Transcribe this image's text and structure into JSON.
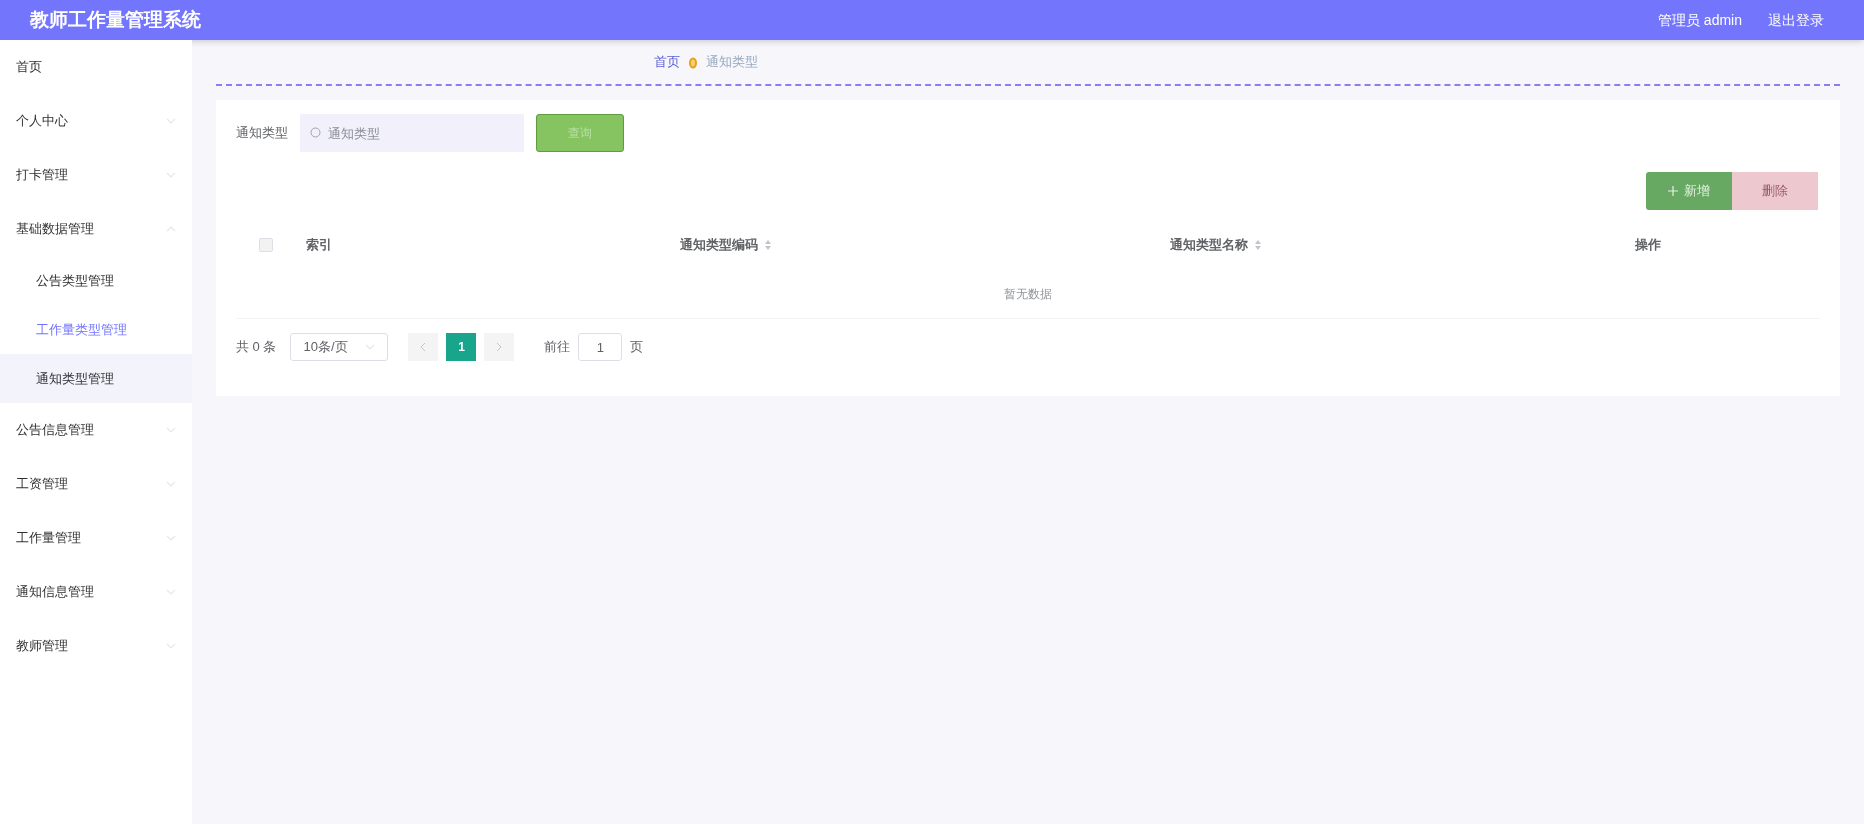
{
  "header": {
    "title": "教师工作量管理系统",
    "user": "管理员 admin",
    "logout": "退出登录"
  },
  "sidebar": {
    "items": [
      {
        "label": "首页",
        "has_arrow": false
      },
      {
        "label": "个人中心",
        "expanded": false,
        "has_arrow": true
      },
      {
        "label": "打卡管理",
        "expanded": false,
        "has_arrow": true
      },
      {
        "label": "基础数据管理",
        "expanded": true,
        "has_arrow": true,
        "children": [
          {
            "label": "公告类型管理",
            "selected": false
          },
          {
            "label": "工作量类型管理",
            "selected": true
          },
          {
            "label": "通知类型管理",
            "selected": false
          }
        ]
      },
      {
        "label": "公告信息管理",
        "expanded": false,
        "has_arrow": true
      },
      {
        "label": "工资管理",
        "expanded": false,
        "has_arrow": true
      },
      {
        "label": "工作量管理",
        "expanded": false,
        "has_arrow": true
      },
      {
        "label": "通知信息管理",
        "expanded": false,
        "has_arrow": true
      },
      {
        "label": "教师管理",
        "expanded": false,
        "has_arrow": true
      }
    ]
  },
  "breadcrumb": [
    "首页",
    "通知类型"
  ],
  "search": {
    "label": "通知类型",
    "placeholder": "通知类型",
    "button": "查询"
  },
  "actions": {
    "add": "新增",
    "delete": "删除"
  },
  "table": {
    "select_all": {
      "checked": false
    },
    "columns": [
      {
        "label": "索引",
        "sortable": false
      },
      {
        "label": "通知类型编码",
        "sortable": true
      },
      {
        "label": "通知类型名称",
        "sortable": true
      },
      {
        "label": "操作",
        "sortable": false
      }
    ],
    "empty": "暂无数据"
  },
  "pagination": {
    "total": "共 0 条",
    "page_size": "10条/页",
    "pages": [
      {
        "label": "1",
        "selected": true
      }
    ],
    "goto_label": "前往",
    "goto_value": "1",
    "goto_suffix": "页"
  }
}
